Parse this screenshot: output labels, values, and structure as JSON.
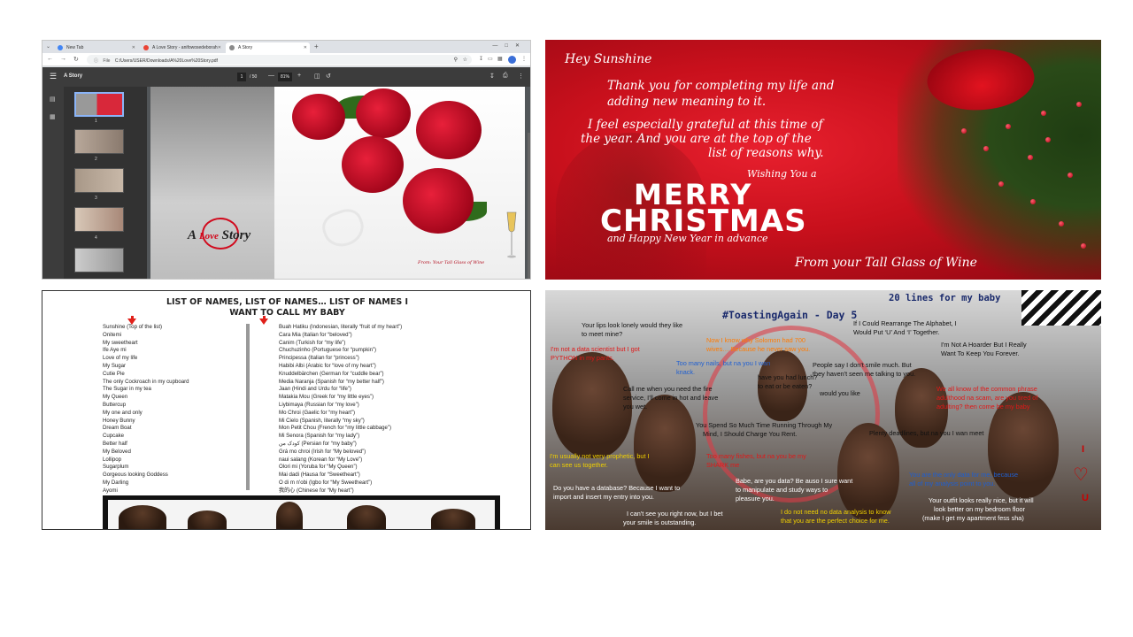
{
  "browser": {
    "tabs": [
      "New Tab",
      "A Love Story - anifowosedeborah",
      "A Story"
    ],
    "new_tab_symbol": "+",
    "url_chip": "File",
    "url": "C:/Users/USER/Downloads/A%20Love%20Story.pdf",
    "pdf_title": "A Story",
    "page_current": "1",
    "page_total": "/ 50",
    "zoom": "81%",
    "thumb_numbers": [
      "1",
      "2",
      "3",
      "4"
    ],
    "cover": {
      "text_a": "A",
      "text_love": "Love",
      "text_story": "Story",
      "signature": "From: Your Tall Glass of Wine"
    }
  },
  "christmas": {
    "hey": "Hey Sunshine",
    "line1": "Thank you for completing my life and",
    "line2": "adding new meaning to it.",
    "line3": "I feel especially grateful at this time of",
    "line4": "the year. And you are at the top of the",
    "line5": "list of reasons why.",
    "wishing": "Wishing You a",
    "merry": "MERRY",
    "christmas": "CHRISTMAS",
    "newyear": "and Happy New Year in advance",
    "from": "From your Tall Glass of Wine"
  },
  "names": {
    "heading1": "LIST OF NAMES, LIST OF NAMES… LIST OF NAMES I",
    "heading2": "WANT TO CALL MY BABY",
    "left": [
      "Sunshine (Top of the list)",
      "Onitemi",
      "My sweetheart",
      "Ife Aye mi",
      "Love of my life",
      "My Sugar",
      "Cutie Pie",
      "The only Cockroach in my cupboard",
      "The Sugar in my tea",
      "My Queen",
      "Buttercup",
      "My one and only",
      "Honey Bunny",
      "Dream Boat",
      "Cupcake",
      "Better half",
      "My Beloved",
      "Lollipop",
      "Sugarplum",
      "Gorgeous looking Goddess",
      "My Darling",
      "Ayomi"
    ],
    "right": [
      "Buah Hatiku (Indonesian, literally “fruit of my heart”)",
      "Cara Mia (Italian for “beloved”)",
      "Canim (Turkish for “my life”)",
      "Chuchuzinho (Portuguese for “pumpkin”)",
      "Principessa (Italian for “princess”)",
      "Habibi Albi (Arabic for “love of my heart”)",
      "Knuddelbärchen (German for “cuddle bear”)",
      "Media Naranja (Spanish for “my better half”)",
      "Jaan (Hindi and Urdu for “life”)",
      "Matakia Mou (Greek for “my little eyes”)",
      "Liybimaya (Russian for “my love”)",
      "Mo Chroi (Gaelic for “my heart”)",
      "Mi Cielo (Spanish, literally “my sky”)",
      "Mon Petit Chou (French for “my little cabbage”)",
      "Mi Senora (Spanish for “my lady”)",
      "کودک من (Persian for “my baby”)",
      "Grá mo chroi (Irish for “My beloved”)",
      "naui salang (Korean for “My Love”)",
      "Olori mi (Yoruba for “My Queen”)",
      "Mai dadi (Hausa for “Sweetheart”)",
      "O di m n'obi (Igbo for “My Sweetheart”)",
      "我的心 (Chinese for “My heart”)"
    ]
  },
  "toasting": {
    "heading": "20 lines for my baby",
    "title": "#ToastingAgain - Day 5",
    "lines": [
      "Your lips look lonely would they like",
      "to meet mine?",
      "I'm not a data scientist but I got",
      "PYTHON in my pants.",
      "Now I know why Solomon had 700",
      "wives… Because he never saw you.",
      "Too many nails, but na you I wan",
      "knack.",
      "If I Could Rearrange The Alphabet, I",
      "Would Put ‘U’ And ‘I’ Together.",
      "I'm Not A Hoarder But I Really",
      "Want To Keep You Forever.",
      "People say I don't smile much. But",
      "they haven't seen me talking to you.",
      "have you had lunch?",
      "to eat or be eaten?",
      "would you like",
      "Call me when you need the fire",
      "service, I'll come in hot and leave",
      "you wet.",
      "We all know of the common phrase",
      "adulthood na scam,  are you tired of",
      "adulting? then come be my baby",
      "You Spend So Much Time Running Through My",
      "Mind, I Should Charge You Rent.",
      "Plenty deadlines, but na you I wan meet",
      "I'm usually not very prophetic, but I",
      "can see us together.",
      "Too many fishes, but na you be my",
      "SHARK me",
      "Babe, are you data? Be auso I sure want",
      "to manipulate and study ways to",
      "pleasure you.",
      "You are the only data for me, because",
      "all of my analysis point to you.",
      "Do you have a database? Because I want to",
      "import and insert my entry into you.",
      "I can't see you right now, but I bet",
      "your smile is outstanding.",
      "I do not need no data analysis to know",
      "that you are the perfect choice for me.",
      "Your outfit looks really nice, but it will",
      "look better on my bedroom floor",
      "(make I get my apartment fess sha)"
    ],
    "side_i": "I",
    "side_u": "U"
  }
}
